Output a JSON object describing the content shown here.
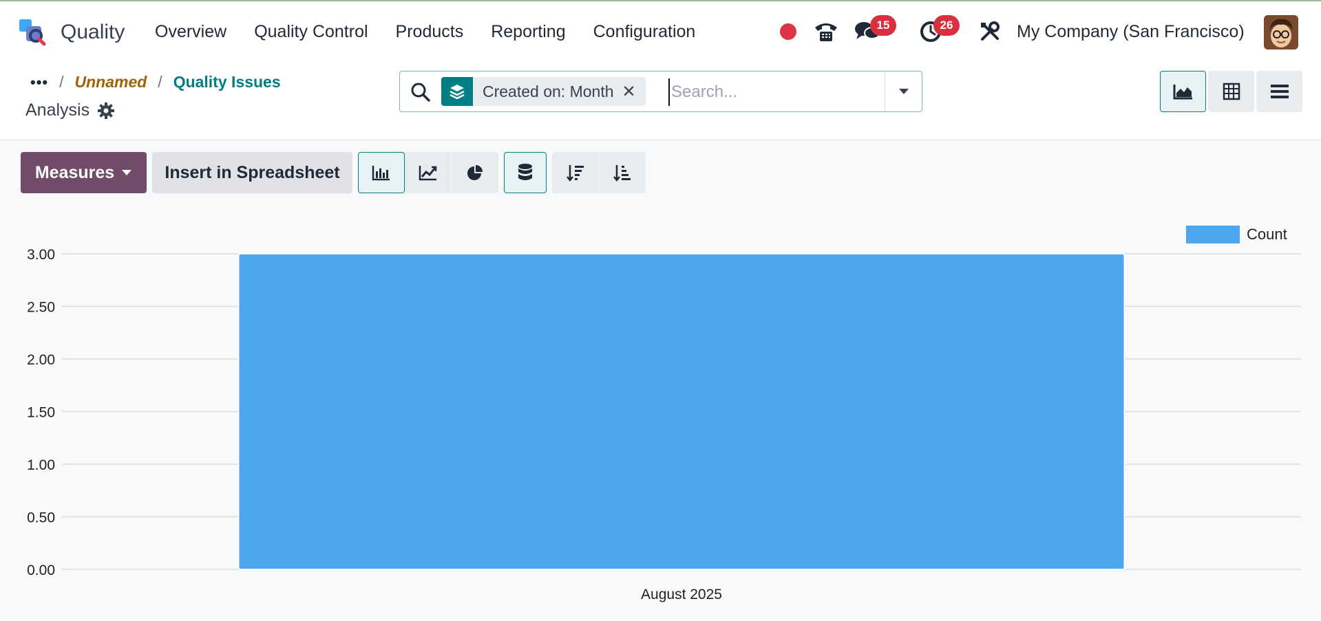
{
  "app": {
    "name": "Quality",
    "menu": [
      "Overview",
      "Quality Control",
      "Products",
      "Reporting",
      "Configuration"
    ],
    "messages_count": "15",
    "activities_count": "26",
    "company": "My Company (San Francisco)"
  },
  "breadcrumb": {
    "dots": "•••",
    "sep": "/",
    "unnamed": "Unnamed",
    "current": "Quality Issues",
    "subtitle": "Analysis"
  },
  "search": {
    "facet_label": "Created on: Month",
    "facet_remove": "✕",
    "placeholder": "Search...",
    "value": ""
  },
  "toolbar": {
    "measures_label": "Measures",
    "spreadsheet_label": "Insert in Spreadsheet"
  },
  "colors": {
    "brand": "#714b67",
    "accent": "#017e84",
    "bar": "#4ea6f0",
    "badge": "#d9303f",
    "recording": "#dc3545"
  },
  "icons": {
    "view_switcher": [
      "area-chart-icon",
      "pivot-icon",
      "list-icon"
    ],
    "chart_types": [
      "bar-chart-icon",
      "line-chart-icon",
      "pie-chart-icon"
    ],
    "stacked": "database-stack-icon",
    "sort": [
      "sort-descending-icon",
      "sort-ascending-icon"
    ]
  },
  "chart_data": {
    "type": "bar",
    "categories": [
      "August 2025"
    ],
    "series": [
      {
        "name": "Count",
        "values": [
          3
        ]
      }
    ],
    "ylim": [
      0,
      3
    ],
    "yticks": [
      "0.00",
      "0.50",
      "1.00",
      "1.50",
      "2.00",
      "2.50",
      "3.00"
    ],
    "legend": "top-right",
    "grid": true
  }
}
